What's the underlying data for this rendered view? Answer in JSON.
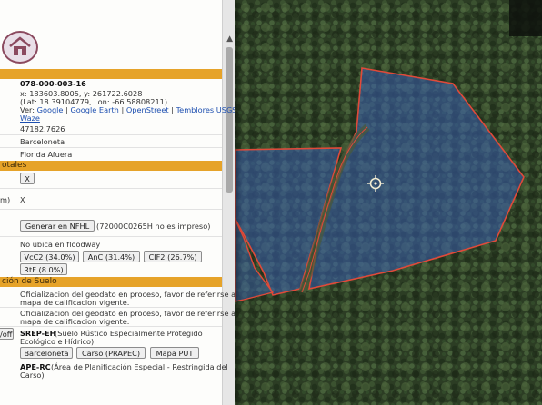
{
  "panel": {
    "parcel_id": "078-000-003-16",
    "coords_xy": "x: 183603.8005, y: 261722.6028",
    "coords_latlon": "(Lat: 18.39104779, Lon: -66.58808211)",
    "view_label": "Ver:",
    "links": [
      "Google",
      "Google Earth",
      "OpenStreet",
      "Temblores USGS",
      "Waze"
    ],
    "area": "47182.7626",
    "municipio": "Barceloneta",
    "barrio": "Florida Afuera",
    "section_totales": "otales",
    "x_button": "X",
    "m_label": "m)",
    "m_value": "X",
    "nfhl_button": "Generar en NFHL",
    "nfhl_note": "(72000C0265H no es impreso)",
    "floodway": "No ubica en floodway",
    "soils": [
      "VcC2 (34.0%)",
      "AnC (31.4%)",
      "CIF2 (26.7%)",
      "RtF (8.0%)"
    ],
    "section_suelo": "ción de Suelo",
    "calif_1_line1": "Oficializacion del geodato en proceso, favor de referirse al",
    "calif_1_line2": "mapa de calificacion vigente.",
    "calif_2_line1": "Oficializacion del geodato en proceso, favor de referirse al",
    "calif_2_line2": "mapa de calificacion vigente.",
    "toggle_off": "/off",
    "srep_code": "SREP-EH",
    "srep_desc_line1": "(Suelo Rústico Especialmente Protegido",
    "srep_desc_line2": "Ecológico e Hídrico)",
    "plan_buttons": [
      "Barceloneta",
      "Carso (PRAPEC)",
      "Mapa PUT"
    ],
    "ape_code": "APE-RC",
    "ape_desc_line1": "(Área de Planificación Especial - Restringida del",
    "ape_desc_line2": "Carso)"
  },
  "colors": {
    "section_bar": "#e6a329",
    "parcel_fill": "#3a5fb0",
    "parcel_stroke": "#e04a3a",
    "link": "#1d4fb0"
  },
  "map": {
    "crosshair_icon": "target-icon"
  }
}
